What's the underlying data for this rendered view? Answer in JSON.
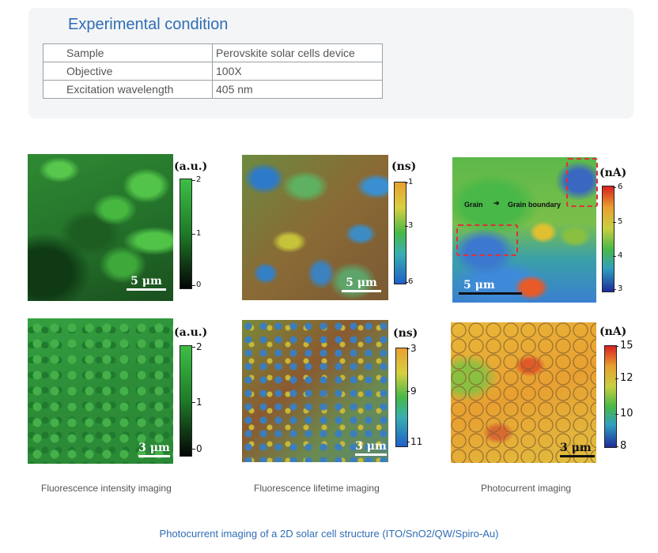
{
  "experimental": {
    "title": "Experimental condition",
    "rows": [
      {
        "key": "Sample",
        "value": "Perovskite solar cells device"
      },
      {
        "key": "Objective",
        "value": "100X"
      },
      {
        "key": "Excitation wavelength",
        "value": "405 nm"
      }
    ]
  },
  "images": {
    "top": [
      {
        "unit": "(a.u.)",
        "ticks": [
          "2",
          "1",
          "0"
        ],
        "scale": "5 μm"
      },
      {
        "unit": "(ns)",
        "ticks": [
          "1",
          "3",
          "6"
        ],
        "scale": "5 μm"
      },
      {
        "unit": "(nA)",
        "ticks": [
          "6",
          "5",
          "4",
          "3"
        ],
        "scale": "5 μm",
        "annotations": {
          "grain": "Grain",
          "boundary": "Grain boundary"
        }
      }
    ],
    "bottom": [
      {
        "unit": "(a.u.)",
        "ticks": [
          "2",
          "1",
          "0"
        ],
        "scale": "3 μm"
      },
      {
        "unit": "(ns)",
        "ticks": [
          "3",
          "9",
          "11"
        ],
        "scale": "3 μm"
      },
      {
        "unit": "(nA)",
        "ticks": [
          "15",
          "12",
          "10",
          "8"
        ],
        "scale": "3 μm"
      }
    ]
  },
  "captions": [
    "Fluorescence intensity imaging",
    "Fluorescence lifetime imaging",
    "Photocurrent imaging"
  ],
  "footer": "Photocurrent imaging of a 2D solar cell structure (ITO/SnO2/QW/Spiro-Au)"
}
